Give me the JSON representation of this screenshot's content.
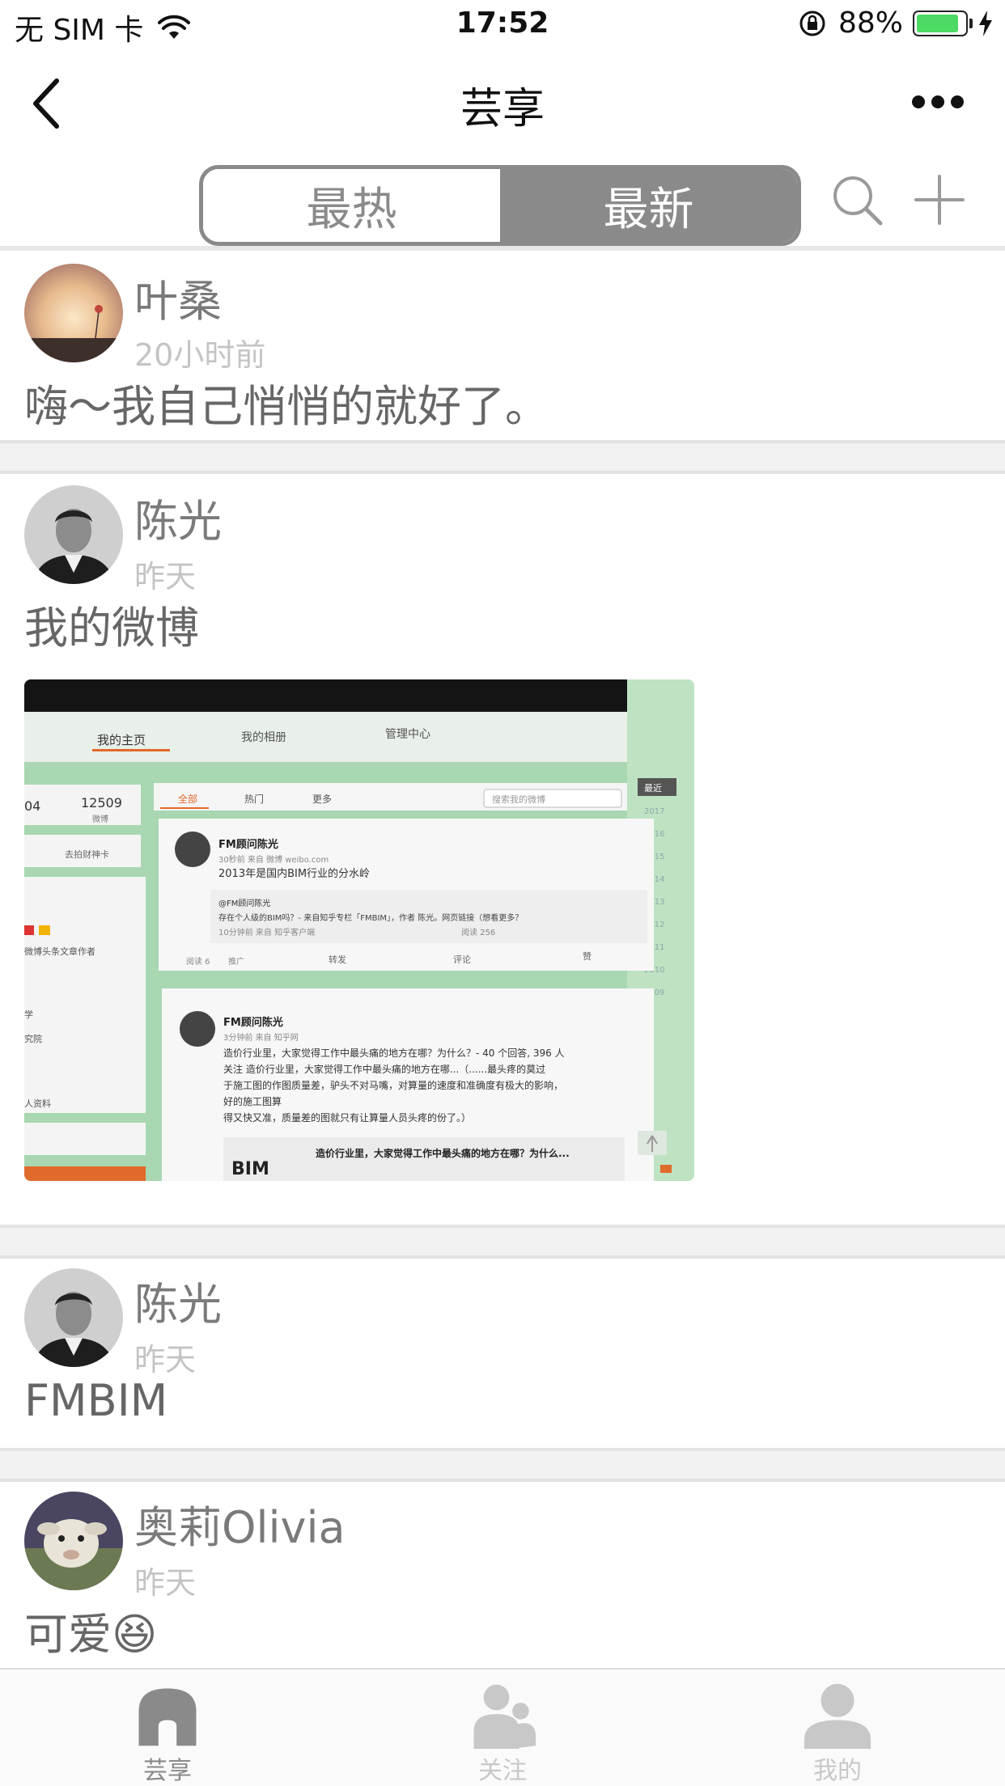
{
  "status_bar": {
    "carrier": "无 SIM 卡",
    "time": "17:52",
    "battery_percent": "88%",
    "battery_level": 0.88,
    "battery_color": "#4cd964"
  },
  "nav": {
    "title": "芸享",
    "back_icon": "chevron-left-icon",
    "more_icon": "ellipsis-icon"
  },
  "segment": {
    "tabs": [
      {
        "label": "最热",
        "selected": false
      },
      {
        "label": "最新",
        "selected": true
      }
    ],
    "accent_color": "#8a8a8a"
  },
  "posts": [
    {
      "name": "叶桑",
      "time": "20小时前",
      "text": "嗨～我自己悄悄的就好了。",
      "avatar": "sunset-balloon-avatar"
    },
    {
      "name": "陈光",
      "time": "昨天",
      "text": "我的微博",
      "avatar": "man-portrait-avatar",
      "has_image": true
    },
    {
      "name": "陈光",
      "time": "昨天",
      "text": "FMBIM",
      "avatar": "man-portrait-avatar"
    },
    {
      "name": "奥莉Olivia",
      "time": "昨天",
      "text": "可爱😆",
      "avatar": "lamb-avatar"
    }
  ],
  "weibo_photo": {
    "nav": [
      "我的主页",
      "我的相册",
      "管理中心"
    ],
    "stats": [
      "04",
      "12509",
      "微博"
    ],
    "filters": [
      "全部",
      "热门",
      "更多"
    ],
    "search_placeholder": "搜索我的微博",
    "side_label": "最近",
    "years": [
      "2017",
      "2016",
      "2015",
      "2014",
      "2013",
      "2012",
      "2011",
      "2010",
      "2009"
    ],
    "left_link": "去拍财神卡",
    "left_items": [
      "微博头条文章作者",
      "学",
      "究院",
      "人资料"
    ],
    "card1": {
      "author": "FM顾问陈光",
      "meta": "30秒前 来自 微博 weibo.com",
      "text": "2013年是国内BIM行业的分水岭",
      "quote_author": "@FM顾问陈光",
      "quote_text": "存在个人级的BIM吗？- 来自知乎专栏「FMBIM」，作者 陈光。网页链接（想看更多？",
      "quote_meta": "10分钟前 来自 知乎客户端",
      "quote_stats": "阅读 256",
      "read": "阅读 6",
      "promote": "推广",
      "actions": [
        "转发",
        "评论",
        "赞"
      ]
    },
    "card2": {
      "author": "FM顾问陈光",
      "meta": "3分钟前 来自 知乎网",
      "text1": "造价行业里，大家觉得工作中最头痛的地方在哪？为什么？- 40 个回答, 396 人",
      "text2": "关注 造价行业里，大家觉得工作中最头痛的地方在哪...（......最头疼的莫过",
      "text3": "于施工图的作图质量差，驴头不对马嘴，对算量的速度和准确度有极大的影响，",
      "text4": "好的施工图算",
      "text5": "得又快又准，质量差的图就只有让算量人员头疼的份了。）",
      "link_title": "造价行业里，大家觉得工作中最头痛的地方在哪？为什么...",
      "logo": "BIM"
    }
  },
  "tab_bar": {
    "items": [
      {
        "label": "芸享",
        "icon": "home-icon",
        "active": true
      },
      {
        "label": "关注",
        "icon": "people-icon",
        "active": false
      },
      {
        "label": "我的",
        "icon": "person-icon",
        "active": false
      }
    ]
  }
}
